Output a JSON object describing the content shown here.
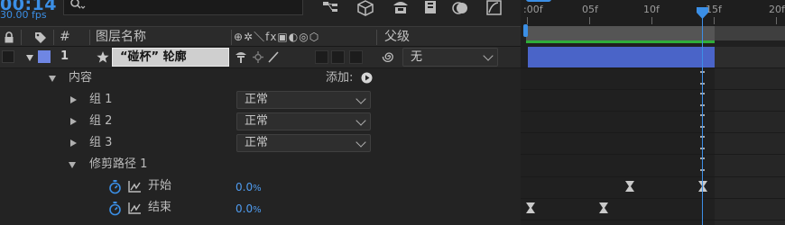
{
  "header": {
    "timecode": "00:14",
    "fps": "30.00 fps",
    "search_placeholder": ""
  },
  "columns": {
    "hash": "#",
    "layer_name": "图层名称",
    "switches_symbols": "⊕✲＼fx▣◐◎⬡",
    "parent": "父级"
  },
  "layer": {
    "index": "1",
    "name": "“碰杯” 轮廓",
    "parent_value": "无",
    "label_color": "#6f86e3"
  },
  "contents": {
    "label": "内容",
    "add_label": "添加:",
    "groups": [
      {
        "label": "组 1",
        "blend": "正常"
      },
      {
        "label": "组 2",
        "blend": "正常"
      },
      {
        "label": "组 3",
        "blend": "正常"
      }
    ],
    "trim": {
      "label": "修剪路径 1",
      "start_label": "开始",
      "start_value": "0.0",
      "end_label": "结束",
      "end_value": "0.0",
      "pct": "%"
    }
  },
  "timeline": {
    "ticks": [
      ":00f",
      "05f",
      "10f",
      "15f",
      "20f"
    ],
    "current_frame": 14,
    "accent": "#3b8fe6",
    "bar_color": "#4a64c8",
    "green": "#2fae3a"
  },
  "icons": [
    "search-icon",
    "lock-icon",
    "label-tag-icon",
    "star-icon",
    "parent-spiral-icon",
    "stopwatch-icon",
    "graph-icon",
    "keyframe-icon",
    "add-circle-icon"
  ]
}
